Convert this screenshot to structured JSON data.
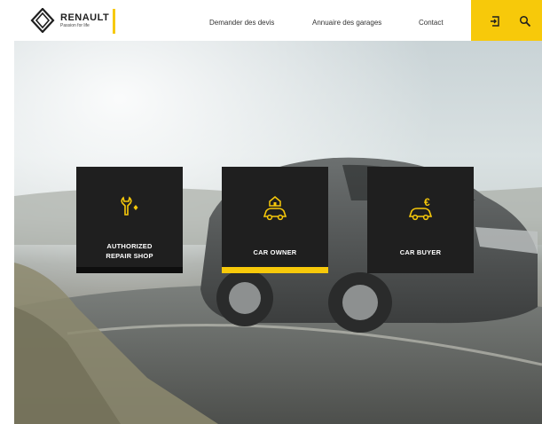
{
  "brand": {
    "name": "RENAULT",
    "slogan": "Passion for life",
    "accent_color": "#f7c90a"
  },
  "nav": {
    "items": [
      {
        "label": "Demander des devis"
      },
      {
        "label": "Annuaire des garages"
      },
      {
        "label": "Contact"
      }
    ],
    "actions": [
      {
        "icon": "login-icon"
      },
      {
        "icon": "search-icon"
      }
    ]
  },
  "cards": [
    {
      "label": "AUTHORIZED REPAIR SHOP",
      "icon": "wrench-icon",
      "active": false
    },
    {
      "label": "CAR OWNER",
      "icon": "car-home-icon",
      "active": true
    },
    {
      "label": "CAR BUYER",
      "icon": "car-euro-icon",
      "active": false
    }
  ]
}
